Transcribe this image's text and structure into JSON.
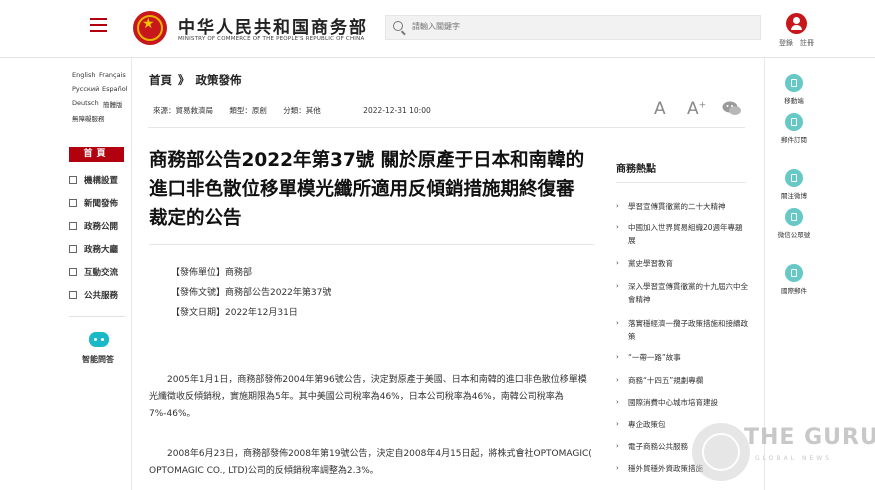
{
  "header": {
    "site_name": "中华人民共和国商务部",
    "site_subtitle": "MINISTRY OF COMMERCE OF THE PEOPLE'S REPUBLIC OF CHINA",
    "search_placeholder": "請輸入關鍵字",
    "login": "登錄",
    "register": "註冊"
  },
  "languages": [
    "English",
    "Français",
    "Русский",
    "Español",
    "Deutsch",
    "簡體版",
    "無障礙服務"
  ],
  "sidebar": {
    "home": "首頁",
    "items": [
      "機構設置",
      "新聞發佈",
      "政務公開",
      "政務大廳",
      "互動交流",
      "公共服務"
    ],
    "assistant": "智能問答"
  },
  "breadcrumb": {
    "home": "首頁",
    "sep": "》",
    "section": "政策發佈"
  },
  "meta": {
    "source": "來源：貿易救濟局",
    "type": "類型：原創",
    "category": "分類：其他",
    "date": "2022-12-31 10:00"
  },
  "font_controls": {
    "large": "A",
    "small": "A",
    "small_sup": "+"
  },
  "article": {
    "title": "商務部公告2022年第37號 關於原產于日本和南韓的進口非色散位移單模光纖所適用反傾銷措施期終復審裁定的公告",
    "fields": [
      "【發佈單位】商務部",
      "【發佈文號】商務部公告2022年第37號",
      "【發文日期】2022年12月31日"
    ],
    "paragraphs": [
      "2005年1月1日，商務部發佈2004年第96號公告，決定對原產于美國、日本和南韓的進口非色散位移單模光纖徵收反傾銷稅，實施期限為5年。其中美國公司稅率為46%，日本公司稅率為46%，南韓公司稅率為7%-46%。",
      "2008年6月23日，商務部發佈2008年第19號公告，決定自2008年4月15日起，將株式會社OPTOMAGIC( OPTOMAGIC CO., LTD)公司的反傾銷稅率調整為2.3%。"
    ]
  },
  "hot": {
    "title": "商務熱點",
    "items": [
      "學習宣傳貫徹黨的二十大精神",
      "中國加入世界貿易組織20週年專題展",
      "黨史學習教育",
      "深入學習宣傳貫徹黨的十九屆六中全會精神",
      "落實穩經濟一攬子政策措施和接續政策",
      "“一帶一路”故事",
      "商務“十四五”規劃專欄",
      "國際消費中心城市培育建設",
      "專企政策包",
      "電子商務公共服務",
      "穩外貿穩外資政策措施"
    ]
  },
  "right_sidebar": [
    "移動端",
    "郵件訂閱",
    "關注微博",
    "微信公眾號",
    "國際郵件"
  ],
  "watermark": {
    "brand": "THE GURU",
    "sub": "GLOBAL NEWS"
  },
  "colors": {
    "brand_red": "#b2000f",
    "teal": "#66c9c6"
  }
}
